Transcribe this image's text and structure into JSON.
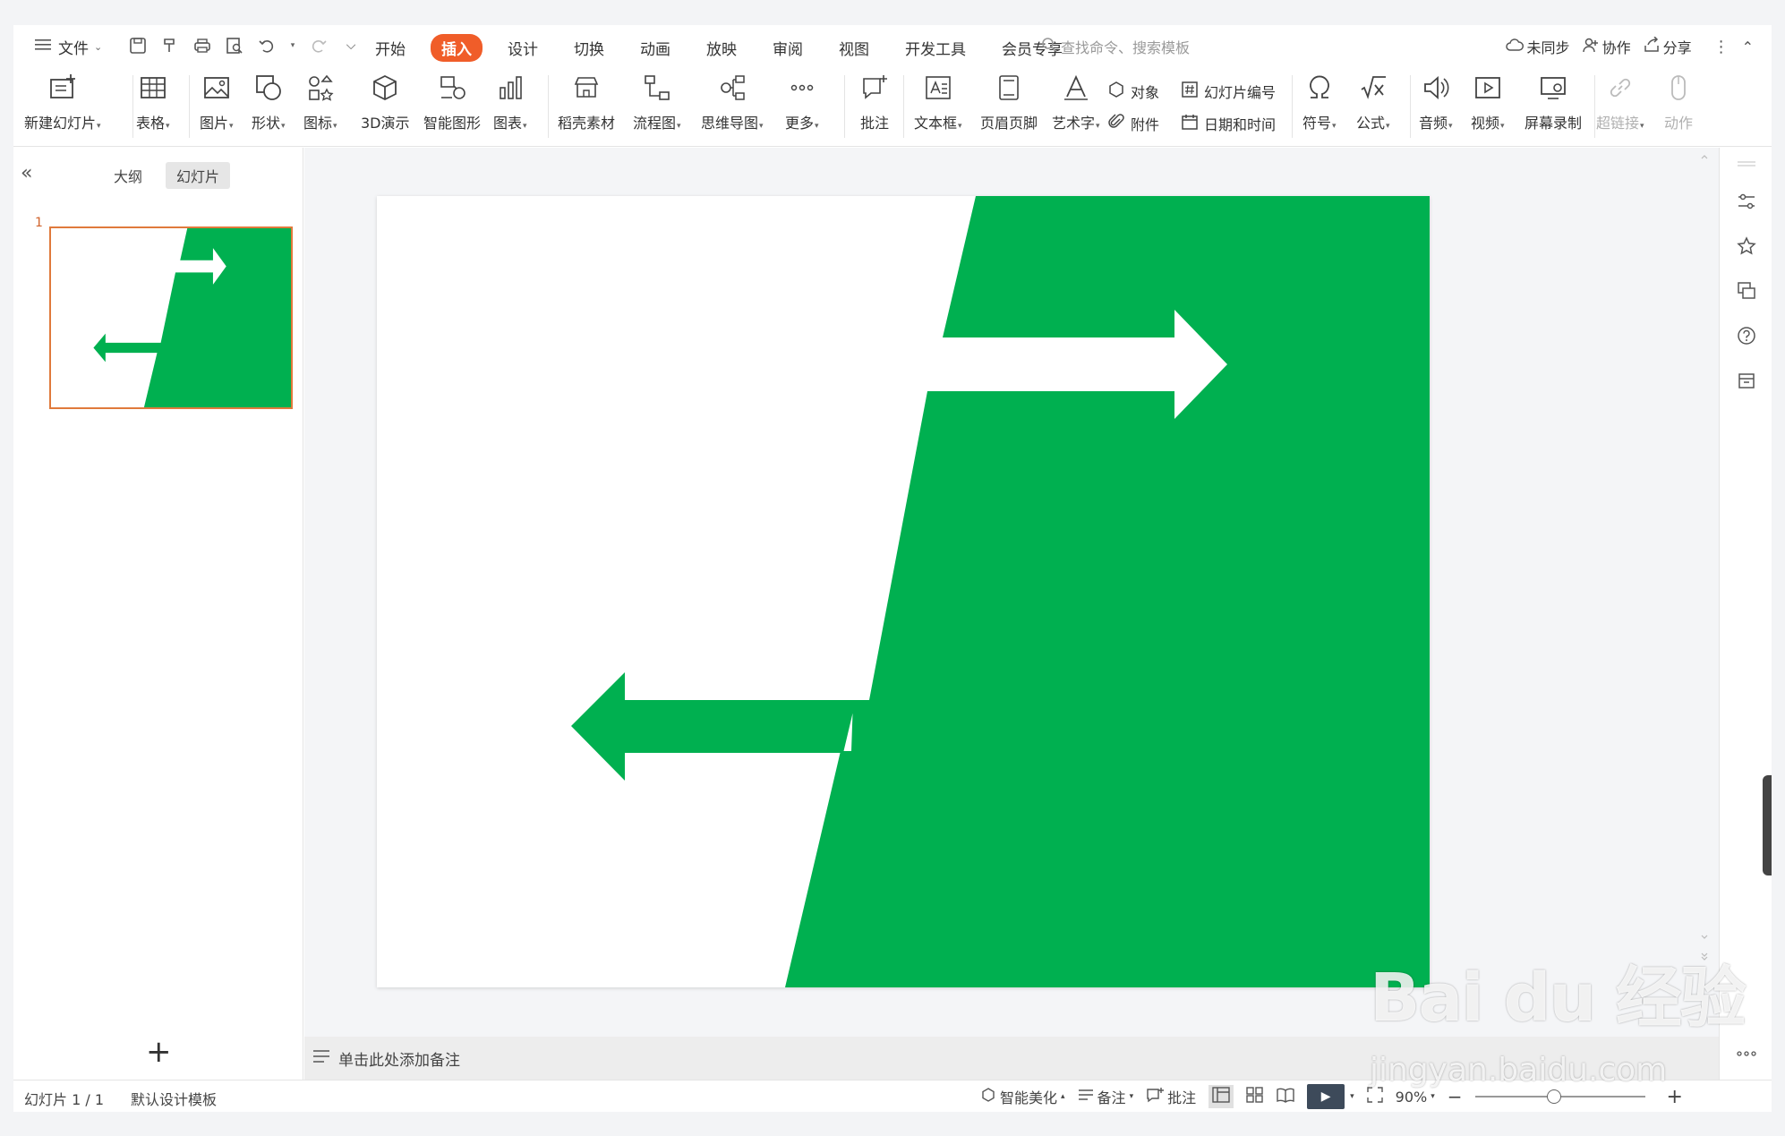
{
  "menu": {
    "file_label": "文件",
    "tabs": [
      "开始",
      "插入",
      "设计",
      "切换",
      "动画",
      "放映",
      "审阅",
      "视图",
      "开发工具",
      "会员专享"
    ],
    "active_tab": "插入",
    "search_placeholder": "查找命令、搜索模板",
    "right": {
      "sync": "未同步",
      "collab": "协作",
      "share": "分享"
    }
  },
  "ribbon": {
    "new_slide": "新建幻灯片",
    "table": "表格",
    "picture": "图片",
    "shape": "形状",
    "icon": "图标",
    "demo3d": "3D演示",
    "smartart": "智能图形",
    "chart": "图表",
    "material": "稻壳素材",
    "flowchart": "流程图",
    "mindmap": "思维导图",
    "more": "更多",
    "comment": "批注",
    "textbox": "文本框",
    "header_footer": "页眉页脚",
    "wordart": "艺术字",
    "object": "对象",
    "attachment": "附件",
    "slide_number": "幻灯片编号",
    "datetime": "日期和时间",
    "symbol": "符号",
    "formula": "公式",
    "audio": "音频",
    "video": "视频",
    "screen_record": "屏幕录制",
    "hyperlink": "超链接",
    "action": "动作"
  },
  "left_panel": {
    "tab_outline": "大纲",
    "tab_slides": "幻灯片",
    "slide_number": "1"
  },
  "slide": {
    "green_color": "#00b050",
    "background_color": "#ffffff"
  },
  "notes": {
    "placeholder": "单击此处添加备注"
  },
  "status": {
    "slide_info": "幻灯片 1 / 1",
    "template": "默认设计模板",
    "beautify": "智能美化",
    "notes": "备注",
    "comment": "批注",
    "zoom": "90%"
  },
  "watermark": {
    "brand": "Bai du 经验",
    "url": "jingyan.baidu.com"
  }
}
